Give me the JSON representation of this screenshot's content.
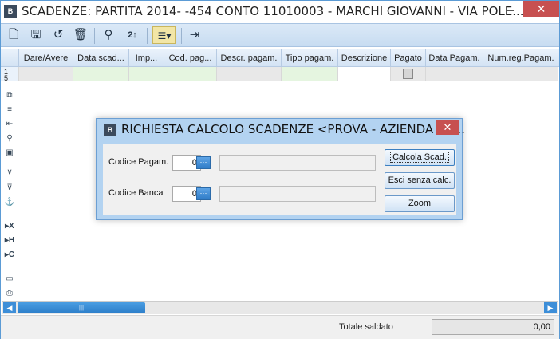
{
  "window": {
    "logo_text": "B",
    "title": "SCADENZE: PARTITA 2014- -454 CONTO 11010003 - MARCHI GIOVANNI  - VIA POLE...",
    "close_glyph": "✕"
  },
  "toolbar": {
    "items": [
      "new-document-icon",
      "save-icon",
      "undo-icon",
      "delete-icon",
      "search-binoculars-icon",
      "sort-icon",
      "list-options-icon",
      "exit-icon"
    ]
  },
  "grid": {
    "columns": [
      "Dare/Avere",
      "Data scad...",
      "Imp...",
      "Cod. pag...",
      "Descr. pagam.",
      "Tipo pagam.",
      "Descrizione",
      "Pagato",
      "Data Pagam.",
      "Num.reg.Pagam."
    ],
    "row_number": "1\n5"
  },
  "dialog": {
    "logo_text": "B",
    "title": "RICHIESTA CALCOLO SCADENZE <PROVA - AZIENDA DI ...",
    "close_glyph": "✕",
    "fields": {
      "codice_pagam_label": "Codice Pagam.",
      "codice_pagam_value": "0",
      "codice_banca_label": "Codice Banca",
      "codice_banca_value": "0"
    },
    "buttons": {
      "calcola": "Calcola Scad.",
      "esci": "Esci senza calc.",
      "zoom": "Zoom"
    }
  },
  "status": {
    "total_label": "Totale saldato",
    "total_value": "0,00"
  },
  "colors": {
    "accent": "#3d8ed8",
    "close": "#c75050",
    "grid_highlight": "#e5f5e0"
  }
}
